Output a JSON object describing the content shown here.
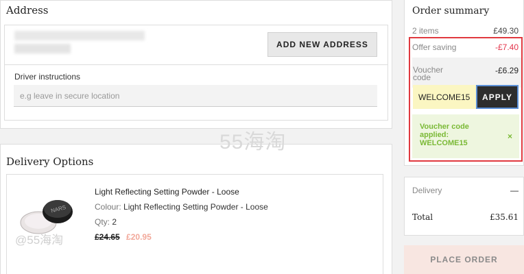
{
  "address": {
    "title": "Address",
    "add_button": "ADD NEW ADDRESS",
    "driver_label": "Driver instructions",
    "driver_placeholder": "e.g leave in secure location"
  },
  "delivery": {
    "title": "Delivery Options",
    "product": {
      "name": "Light Reflecting Setting Powder - Loose",
      "colour_label": "Colour:",
      "colour_value": "Light Reflecting Setting Powder - Loose",
      "qty_label": "Qty:",
      "qty_value": "2",
      "old_price": "£24.65",
      "new_price": "£20.95",
      "image_icon": "powder-jar-icon"
    }
  },
  "summary": {
    "title": "Order summary",
    "items_label": "2 items",
    "items_value": "£49.30",
    "offer_label": "Offer saving",
    "offer_value": "-£7.40",
    "voucher_label_line1": "Voucher",
    "voucher_label_line2": "code",
    "voucher_value": "-£6.29",
    "voucher_input_value": "WELCOME15",
    "apply_label": "APPLY",
    "applied_line1": "Voucher code",
    "applied_line2": "applied:",
    "applied_line3": "WELCOME15",
    "applied_close": "×",
    "delivery_label": "Delivery",
    "delivery_value": "—",
    "total_label": "Total",
    "total_value": "£35.61",
    "place_order": "PLACE ORDER"
  },
  "watermark": {
    "center": "55海淘",
    "corner": "@55海淘"
  },
  "colors": {
    "offer_red": "#e3334a",
    "applied_green": "#7ab935",
    "voucher_input_bg": "#fbf6c2",
    "highlight_border": "#e0383e",
    "place_order_bg": "#f8e6e1"
  }
}
